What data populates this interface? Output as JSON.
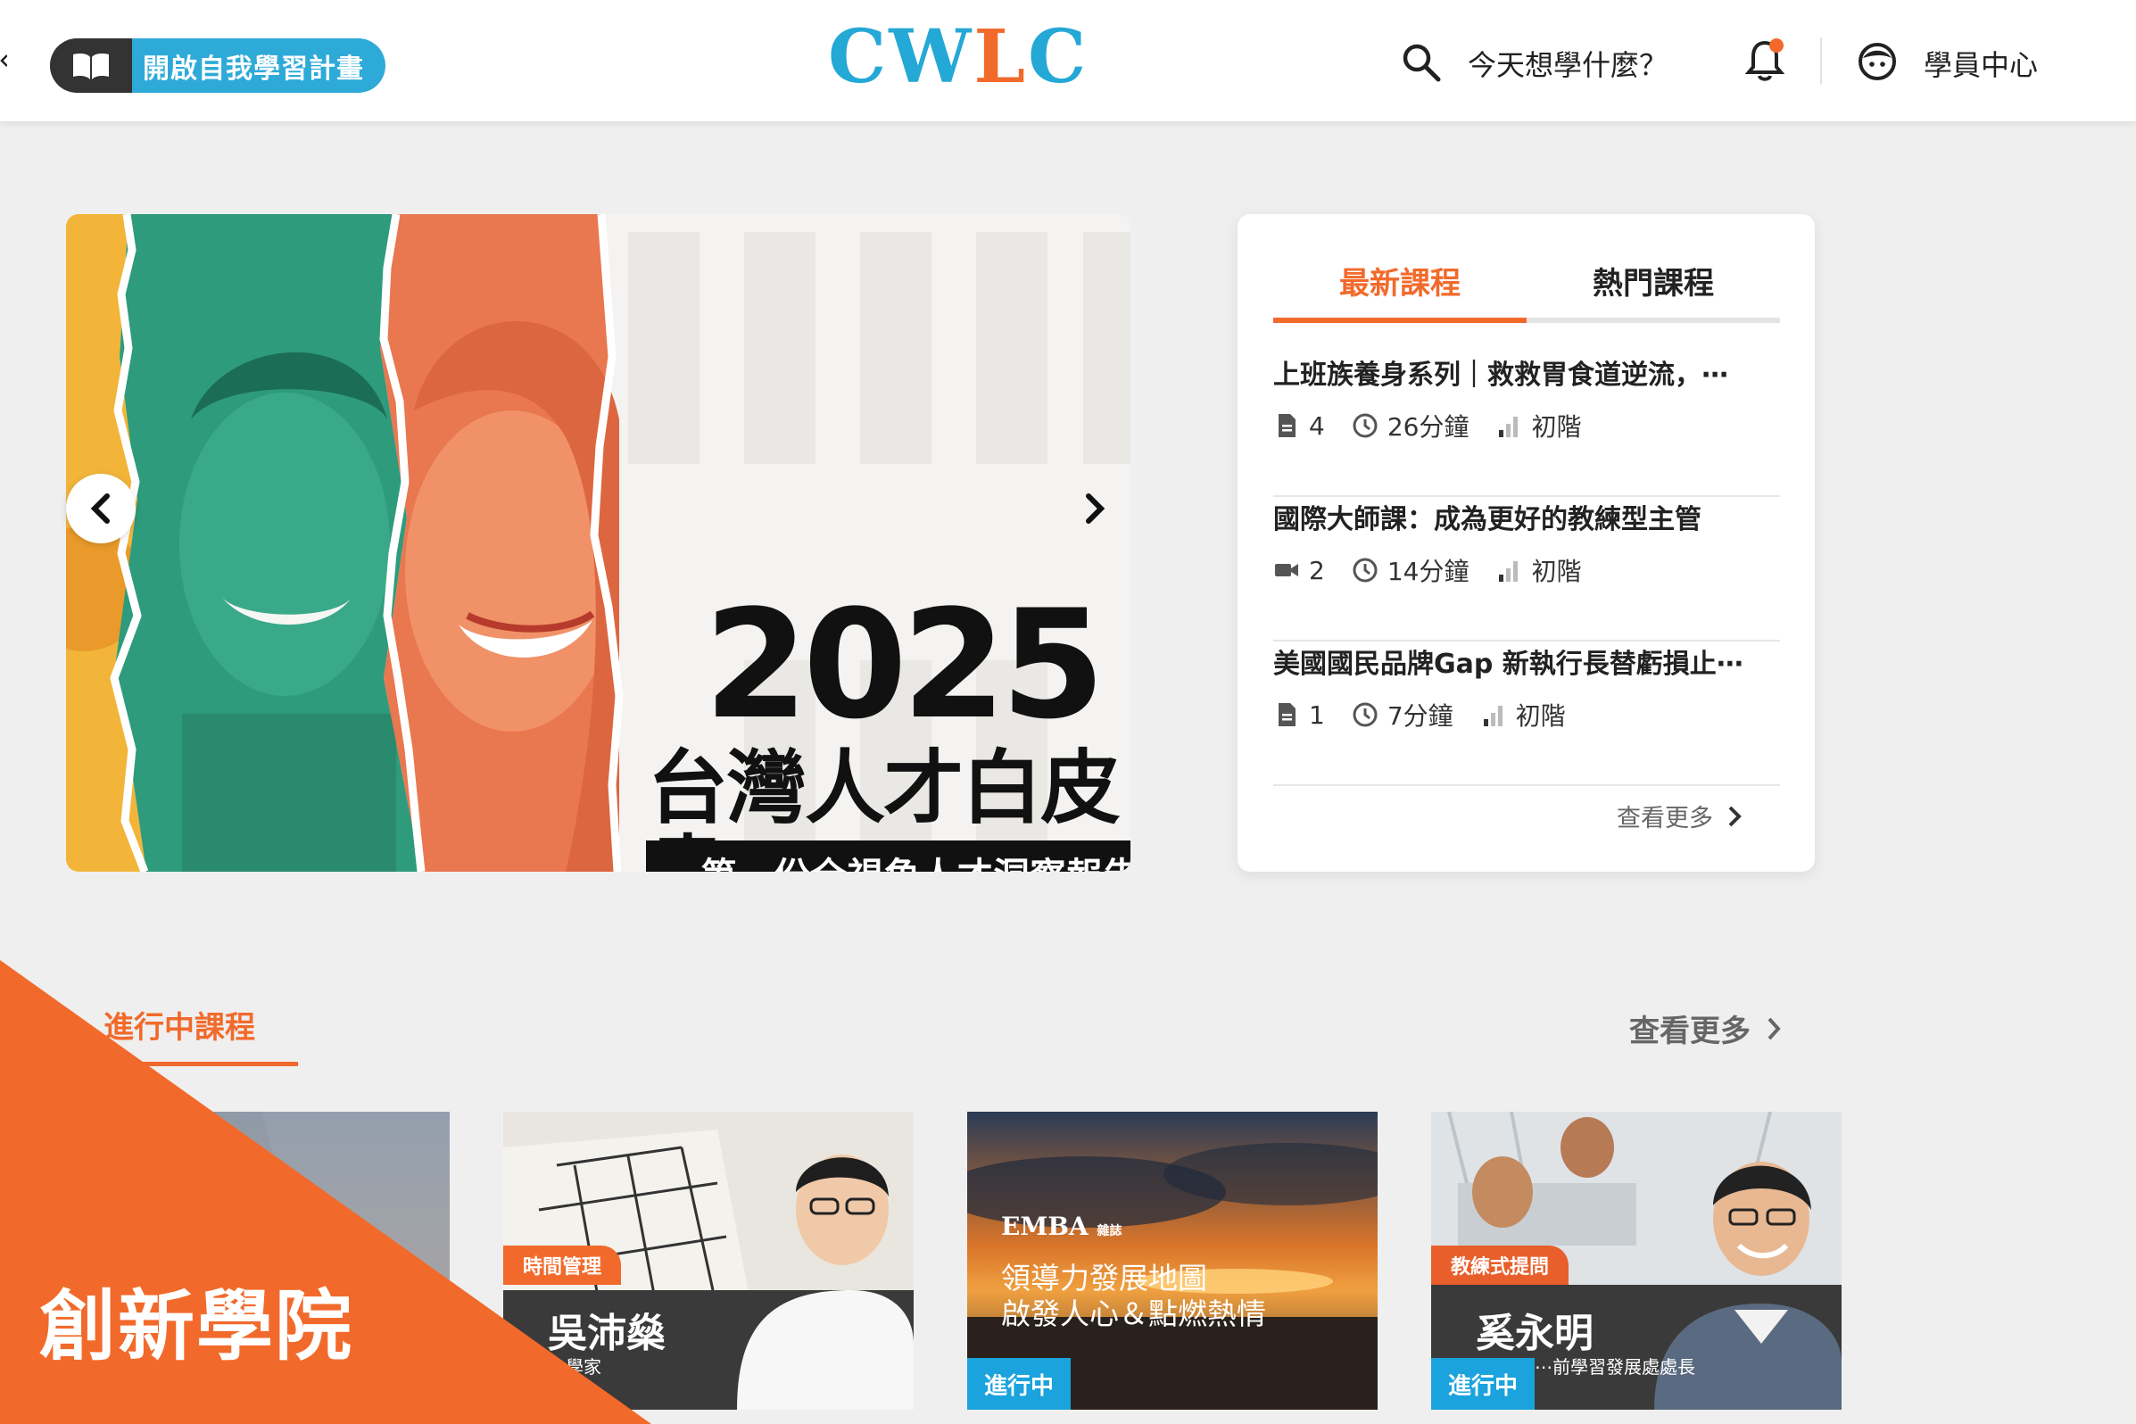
{
  "header": {
    "plan_button_label": "開啟自我學習計畫",
    "logo_text": [
      "C",
      "W",
      "L",
      "C"
    ],
    "search_prompt": "今天想學什麼？",
    "user_center_label": "學員中心"
  },
  "banner": {
    "year": "2025",
    "title": "台灣人才白皮書",
    "subtitle": "第一份全視角人才洞察報告"
  },
  "panel": {
    "tabs": [
      {
        "label": "最新課程",
        "active": true
      },
      {
        "label": "熱門課程",
        "active": false
      }
    ],
    "courses": [
      {
        "title": "上班族養身系列｜救救胃食道逆流，⋯",
        "media_icon": "document-icon",
        "count": "4",
        "duration": "26分鐘",
        "level": "初階"
      },
      {
        "title": "國際大師課：成為更好的教練型主管",
        "media_icon": "video-icon",
        "count": "2",
        "duration": "14分鐘",
        "level": "初階"
      },
      {
        "title": "美國國民品牌Gap 新執行長替虧損止⋯",
        "media_icon": "document-icon",
        "count": "1",
        "duration": "7分鐘",
        "level": "初階"
      }
    ],
    "more_label": "查看更多"
  },
  "in_progress": {
    "section_title": "進行中課程",
    "more_label": "查看更多",
    "cards": [
      {
        "category": "",
        "instructor": "",
        "role": "",
        "status": ""
      },
      {
        "category": "時間管理",
        "instructor": "吳沛燊",
        "role": "⋯學家",
        "status": ""
      },
      {
        "category": "",
        "caption_brand": "EMBA",
        "caption_brand_small": "雜誌",
        "caption_line1": "領導力發展地圖",
        "caption_line2": "啟發人心＆點燃熱情",
        "status": "進行中"
      },
      {
        "category": "教練式提問",
        "instructor": "奚永明",
        "role": "⋯前學習發展處處長",
        "status": "進行中"
      }
    ]
  },
  "corner_ribbon": {
    "label": "創新學院",
    "color": "#f26a2b"
  },
  "colors": {
    "accent_orange": "#f26a2b",
    "accent_blue": "#24a8d6"
  }
}
